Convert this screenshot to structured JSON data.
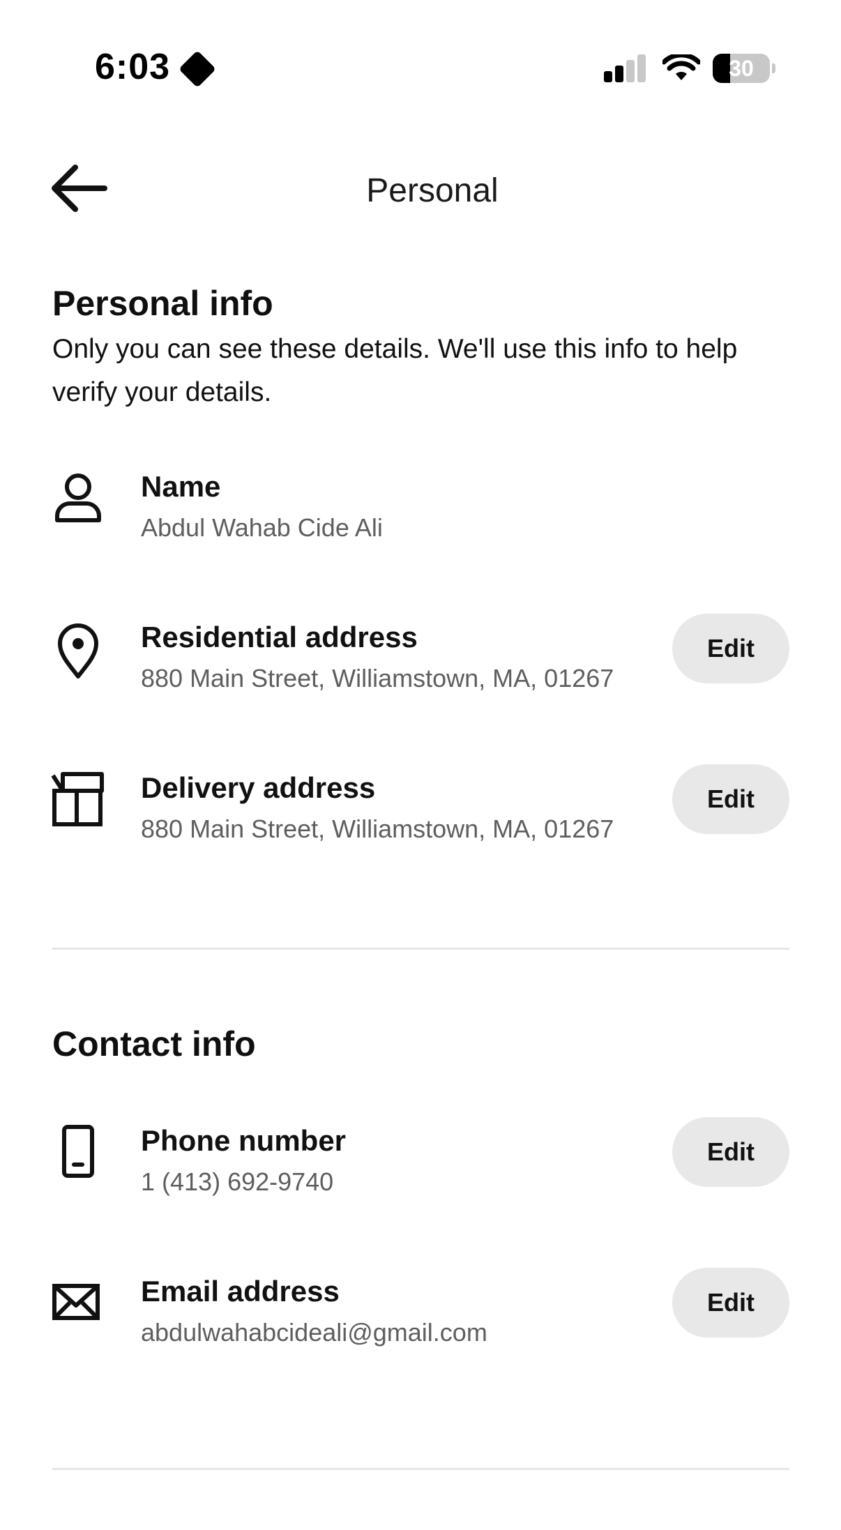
{
  "status_bar": {
    "time": "6:03",
    "battery_level": "30",
    "battery_fraction": 0.3,
    "signal_bars_active": 2,
    "signal_bars_total": 4
  },
  "header": {
    "title": "Personal",
    "back_icon": "arrow-left-icon"
  },
  "personal_info": {
    "title": "Personal info",
    "description": "Only you can see these details. We'll use this info to help verify your details.",
    "items": [
      {
        "icon": "person-icon",
        "label": "Name",
        "value": "Abdul Wahab  Cide Ali",
        "editable": false
      },
      {
        "icon": "location-pin-icon",
        "label": "Residential address",
        "value": "880 Main Street, Williamstown, MA, 01267",
        "editable": true,
        "edit_label": "Edit"
      },
      {
        "icon": "package-icon",
        "label": "Delivery address",
        "value": "880 Main Street, Williamstown, MA, 01267",
        "editable": true,
        "edit_label": "Edit"
      }
    ]
  },
  "contact_info": {
    "title": "Contact info",
    "items": [
      {
        "icon": "phone-icon",
        "label": "Phone number",
        "value": "1 (413) 692-9740",
        "editable": true,
        "edit_label": "Edit"
      },
      {
        "icon": "envelope-icon",
        "label": "Email address",
        "value": "abdulwahabcideali@gmail.com",
        "editable": true,
        "edit_label": "Edit"
      }
    ]
  },
  "colors": {
    "background": "#ffffff",
    "text_primary": "#111111",
    "text_secondary": "#5e5e5e",
    "button_bg": "#e8e8e8",
    "divider": "#e6e6e6"
  }
}
